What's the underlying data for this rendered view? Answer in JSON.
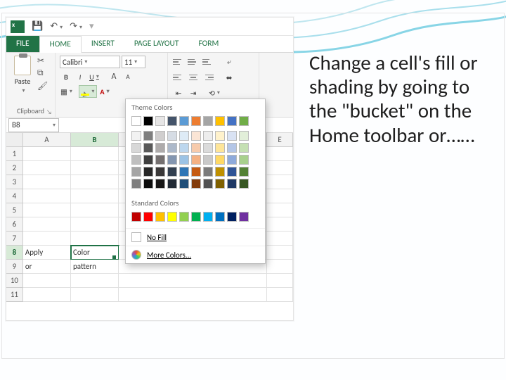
{
  "caption": "Change a cell's fill or shading by going to the \"bucket\" on the Home toolbar or……",
  "qat": {
    "app": "Excel",
    "save": "Save",
    "undo": "Undo",
    "redo": "Redo"
  },
  "tabs": {
    "file": "FILE",
    "home": "HOME",
    "insert": "INSERT",
    "pagelayout": "PAGE LAYOUT",
    "formulas": "FORM"
  },
  "ribbon": {
    "paste": "Paste",
    "clipboard": "Clipboard",
    "font_name": "Calibri",
    "font_size": "11",
    "bold": "B",
    "italic": "I",
    "underline": "U",
    "grow": "A",
    "shrink": "A"
  },
  "namebox": "B8",
  "columns": [
    "A",
    "B",
    "E"
  ],
  "rows": [
    "1",
    "2",
    "3",
    "4",
    "5",
    "6",
    "7",
    "8",
    "9",
    "10",
    "11"
  ],
  "cells": {
    "A8": "Apply",
    "B8": "Color",
    "A9": "or",
    "B9": "pattern"
  },
  "dropdown": {
    "theme_label": "Theme Colors",
    "standard_label": "Standard Colors",
    "no_fill": "No Fill",
    "more_colors": "More Colors...",
    "theme_base": [
      "#ffffff",
      "#000000",
      "#e7e6e6",
      "#44546a",
      "#5b9bd5",
      "#ed7d31",
      "#a5a5a5",
      "#ffc000",
      "#4472c4",
      "#70ad47"
    ],
    "theme_tints": [
      [
        "#f2f2f2",
        "#7f7f7f",
        "#d0cece",
        "#d6dce4",
        "#deebf6",
        "#fbe5d5",
        "#ededed",
        "#fff2cc",
        "#d9e2f3",
        "#e2efd9"
      ],
      [
        "#d8d8d8",
        "#595959",
        "#aeabab",
        "#adb9ca",
        "#bdd7ee",
        "#f7cbac",
        "#dbdbdb",
        "#fee599",
        "#b4c6e7",
        "#c5e0b3"
      ],
      [
        "#bfbfbf",
        "#3f3f3f",
        "#757070",
        "#8496b0",
        "#9cc3e5",
        "#f4b183",
        "#c9c9c9",
        "#ffd965",
        "#8eaadb",
        "#a8d08d"
      ],
      [
        "#a5a5a5",
        "#262626",
        "#3a3838",
        "#323f4f",
        "#2e75b5",
        "#c55a11",
        "#7b7b7b",
        "#bf9000",
        "#2f5496",
        "#538135"
      ],
      [
        "#7f7f7f",
        "#0c0c0c",
        "#171616",
        "#222a35",
        "#1f4e79",
        "#833c0b",
        "#525252",
        "#7f6000",
        "#1f3864",
        "#375623"
      ]
    ],
    "standard": [
      "#c00000",
      "#ff0000",
      "#ffc000",
      "#ffff00",
      "#92d050",
      "#00b050",
      "#00b0f0",
      "#0070c0",
      "#002060",
      "#7030a0"
    ]
  }
}
